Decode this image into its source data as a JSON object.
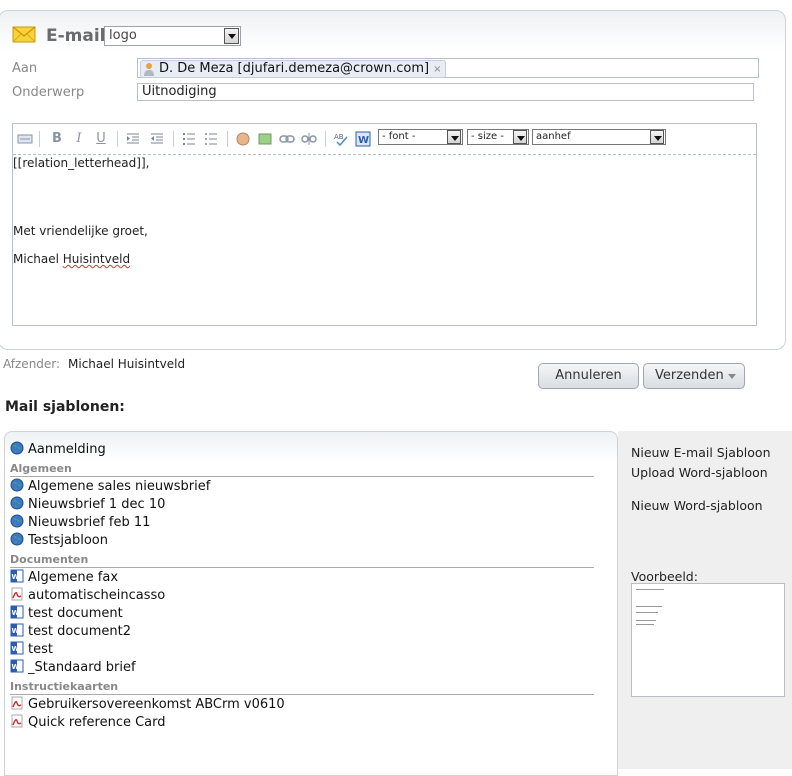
{
  "header": {
    "title": "E-mail",
    "logo_select": "logo"
  },
  "form": {
    "to_label": "Aan",
    "subject_label": "Onderwerp",
    "recipient": "D. De Meza [djufari.demeza@crown.com]",
    "recipient_remove": "×",
    "subject_value": "Uitnodiging"
  },
  "toolbar": {
    "bold": "B",
    "italic": "I",
    "underline": "U",
    "font_select": "- font -",
    "size_select": "- size -",
    "style_select": "aanhef"
  },
  "editor": {
    "lines": [
      "[[relation_letterhead]],",
      "Met vriendelijke groet,",
      "Michael ",
      "Huisintveld"
    ]
  },
  "sender": {
    "label": "Afzender:",
    "value": "Michael Huisintveld"
  },
  "buttons": {
    "cancel": "Annuleren",
    "send": "Verzenden"
  },
  "templates": {
    "heading": "Mail sjablonen:",
    "top_items": [
      "Aanmelding"
    ],
    "groups": [
      {
        "name": "Algemeen",
        "items": [
          "Algemene sales nieuwsbrief",
          "Nieuwsbrief 1 dec 10",
          "Nieuwsbrief feb 11",
          "Testsjabloon"
        ]
      },
      {
        "name": "Documenten",
        "items": [
          "Algemene fax",
          "automatischeincasso",
          "test document",
          "test document2",
          "test",
          "_Standaard brief"
        ]
      },
      {
        "name": "Instructiekaarten",
        "items": [
          "Gebruikersovereenkomst ABCrm v0610",
          "Quick reference Card"
        ]
      }
    ]
  },
  "sidebar": {
    "new_email_template": "Nieuw E-mail Sjabloon",
    "upload_word_template": "Upload Word-sjabloon",
    "new_word_template": "Nieuw Word-sjabloon",
    "preview_label": "Voorbeeld:"
  },
  "colors": {
    "accent_icon_envelope": "#f5c518",
    "pdf_red": "#cc2a2a",
    "word_blue": "#2b5cad"
  }
}
